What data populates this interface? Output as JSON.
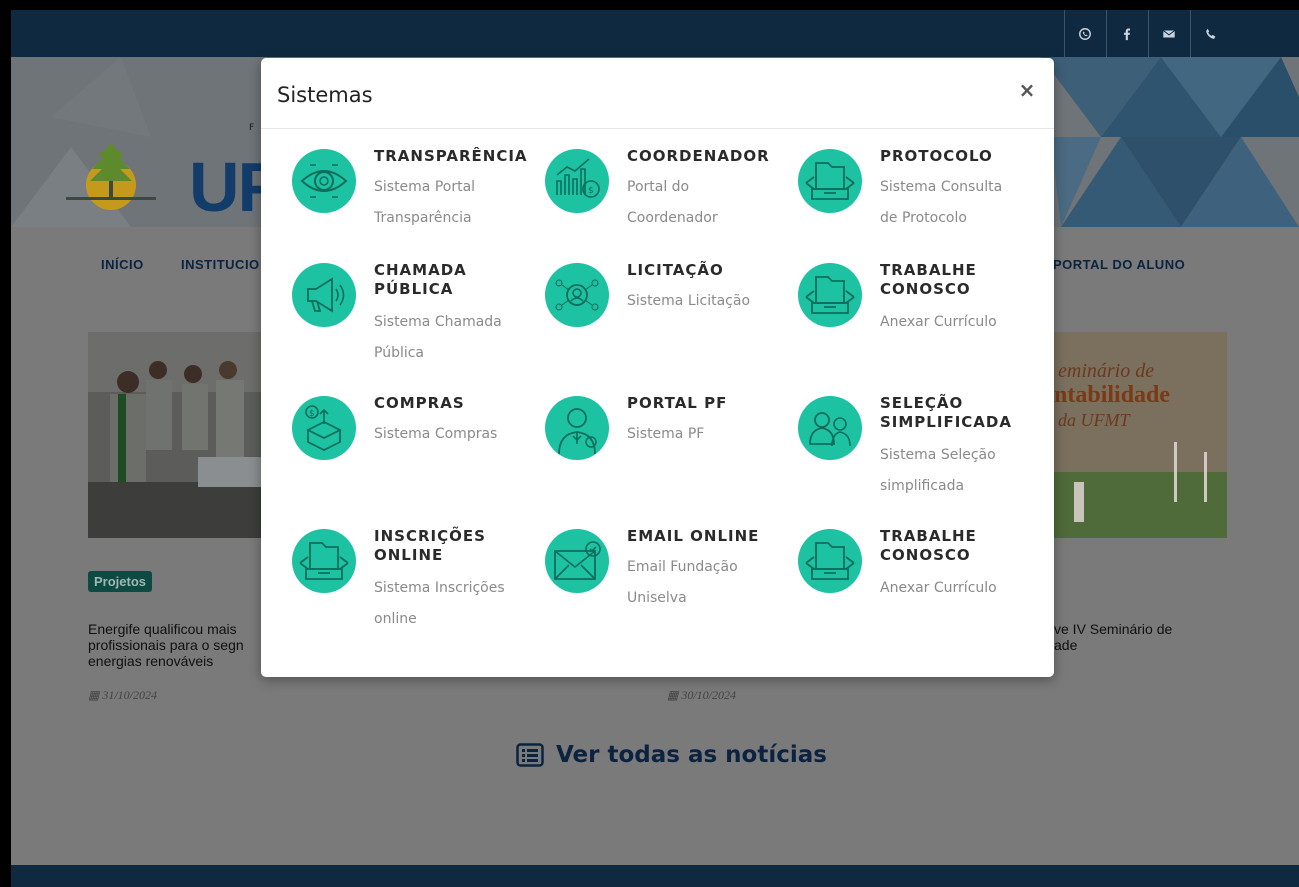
{
  "modal": {
    "title": "Sistemas",
    "close_label": "×",
    "systems": [
      {
        "title": "TRANSPARÊNCIA",
        "desc_lines": [
          "Sistema Portal",
          "Transparência"
        ],
        "icon": "eye-icon"
      },
      {
        "title": "COORDENADOR",
        "desc_lines": [
          "Portal do",
          "Coordenador"
        ],
        "icon": "chart-icon"
      },
      {
        "title": "PROTOCOLO",
        "desc_lines": [
          "Sistema Consulta",
          "de Protocolo"
        ],
        "icon": "folder-tray-icon"
      },
      {
        "title_lines": [
          "CHAMADA",
          "PÚBLICA"
        ],
        "desc_lines": [
          "Sistema Chamada",
          "Pública"
        ],
        "icon": "megaphone-icon"
      },
      {
        "title": "LICITAÇÃO",
        "desc_lines": [
          "Sistema Licitação"
        ],
        "icon": "network-user-icon"
      },
      {
        "title_lines": [
          "TRABALHE",
          "CONOSCO"
        ],
        "desc_lines": [
          "Anexar Currículo"
        ],
        "icon": "folder-tray-icon"
      },
      {
        "title": "COMPRAS",
        "desc_lines": [
          "Sistema Compras"
        ],
        "icon": "money-box-icon"
      },
      {
        "title": "PORTAL PF",
        "desc_lines": [
          "Sistema PF"
        ],
        "icon": "person-icon"
      },
      {
        "title_lines": [
          "SELEÇÃO",
          "SIMPLIFICADA"
        ],
        "desc_lines": [
          "Sistema Seleção",
          "simplificada"
        ],
        "icon": "people-icon"
      },
      {
        "title_lines": [
          "INSCRIÇÕES",
          "ONLINE"
        ],
        "desc_lines": [
          "Sistema Inscrições",
          "online"
        ],
        "icon": "folder-tray-icon"
      },
      {
        "title": "EMAIL ONLINE",
        "desc_lines": [
          "Email Fundação",
          "Uniselva"
        ],
        "icon": "email-icon"
      },
      {
        "title_lines": [
          "TRABALHE",
          "CONOSCO"
        ],
        "desc_lines": [
          "Anexar Currículo"
        ],
        "icon": "folder-tray-icon"
      }
    ]
  },
  "topbar": {
    "icons": [
      "whatsapp-icon",
      "facebook-icon",
      "email-icon",
      "phone-icon"
    ]
  },
  "header": {
    "logo_text": "UF",
    "logo_small": "F"
  },
  "nav": {
    "items": [
      "INÍCIO",
      "INSTITUCIO",
      "PORTAL DO ALUNO"
    ]
  },
  "news": {
    "tag": "Projetos",
    "items": [
      {
        "lines": [
          "Energife qualificou mais",
          "profissionais para o segn",
          "energias renováveis"
        ],
        "date": "31/10/2024"
      },
      {
        "lines": [],
        "date": "30/10/2024"
      },
      {
        "lines": [
          "ve IV Seminário de",
          "ade"
        ],
        "date": ""
      }
    ],
    "banner_lines": [
      "eminário de",
      "ntabilidade",
      "da UFMT"
    ],
    "see_all": "Ver todas as notícias"
  },
  "colors": {
    "accent": "#1cc2a2",
    "navy": "#0f2a40"
  }
}
